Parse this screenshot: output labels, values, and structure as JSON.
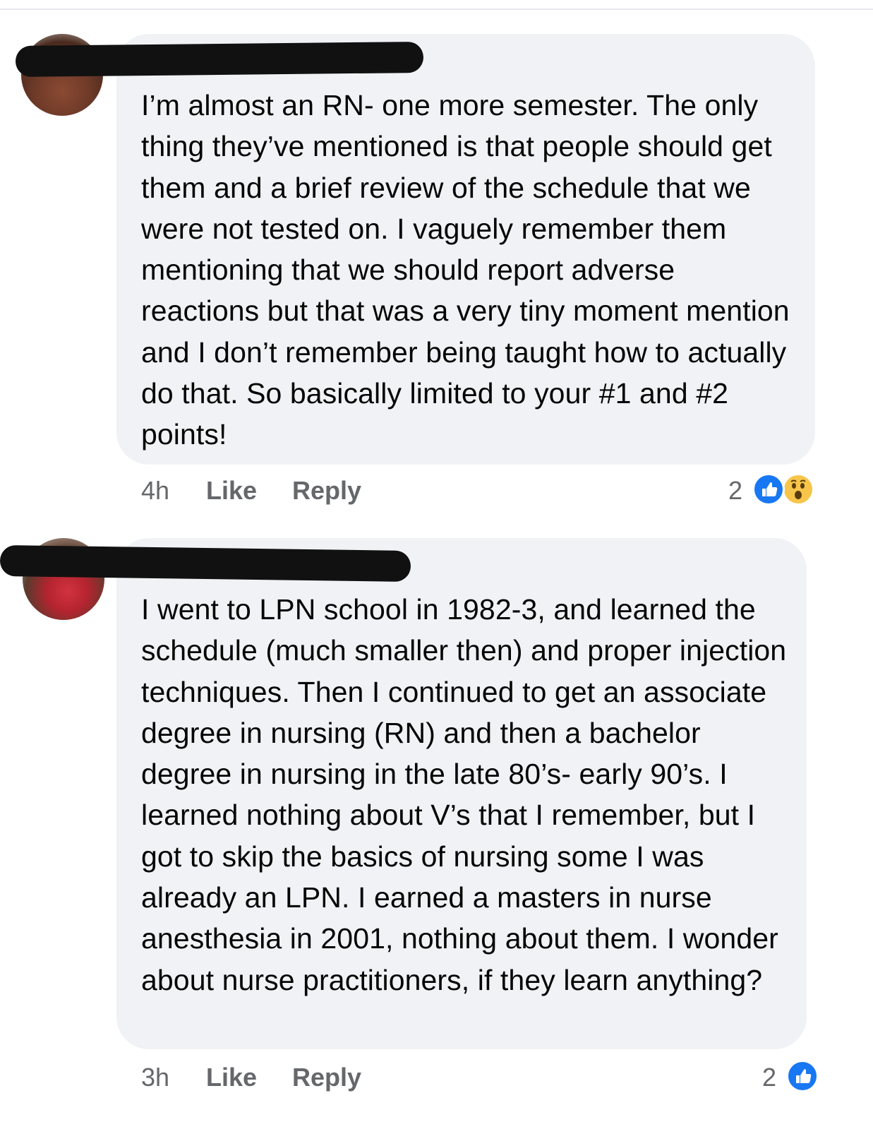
{
  "comments": [
    {
      "text": "I’m almost an RN- one more semester. The only thing they’ve mentioned is that people should get them and a brief review of the schedule that we were not tested on. I vaguely remember them mentioning that we should report adverse reactions but that was a very tiny moment mention and I don’t remember being taught how to actually do that. So basically limited to your #1 and #2 points!",
      "time": "4h",
      "like_label": "Like",
      "reply_label": "Reply",
      "reaction_count": "2",
      "reactions": [
        "like-icon",
        "wow-icon"
      ]
    },
    {
      "text": "I went to LPN school in 1982-3, and learned the schedule (much smaller then) and proper injection techniques. Then I continued to get an associate degree in nursing (RN) and then a bachelor degree in nursing in the late 80’s- early 90’s. I learned nothing about V’s that I remember, but I got to skip the basics of nursing some I was already an LPN. I earned a masters in nurse anesthesia in 2001, nothing about them. I wonder about nurse practitioners, if they learn anything?",
      "time": "3h",
      "like_label": "Like",
      "reply_label": "Reply",
      "reaction_count": "2",
      "reactions": [
        "like-icon"
      ]
    }
  ],
  "colors": {
    "bubble": "#f0f2f5",
    "meta_text": "#65676b",
    "like_blue": "#1877f2",
    "wow_yellow": "#f7c54a"
  }
}
